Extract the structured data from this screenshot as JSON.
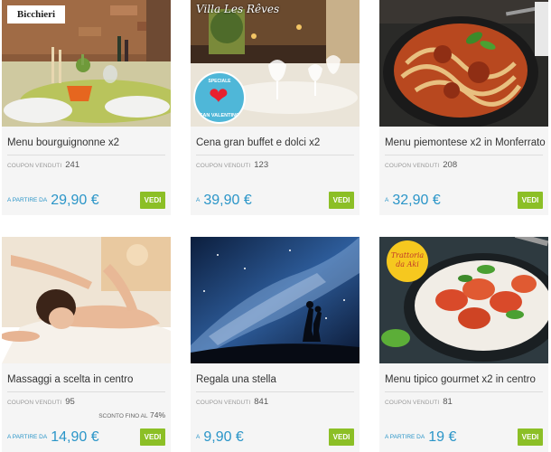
{
  "labels": {
    "sold": "COUPON VENDUTI",
    "from": "A PARTIRE DA",
    "discount": "SCONTO FINO AL",
    "cta": "VEDI"
  },
  "cards": [
    {
      "title": "Menu bourguignonne x2",
      "sold": "241",
      "price": "29,90 €",
      "logo": "Bicchieri"
    },
    {
      "title": "Cena gran buffet e dolci x2",
      "sold": "123",
      "price": "39,90 €",
      "logo": "Villa Les Rêves",
      "badge_top": "SPECIALE",
      "badge_bottom": "SAN VALENTINO"
    },
    {
      "title": "Menu piemontese x2 in Monferrato",
      "sold": "208",
      "price": "32,90 €"
    },
    {
      "title": "Massaggi a scelta in centro",
      "sold": "95",
      "price": "14,90 €",
      "discount": "74%"
    },
    {
      "title": "Regala una stella",
      "sold": "841",
      "price": "9,90 €"
    },
    {
      "title": "Menu tipico gourmet x2 in centro",
      "sold": "81",
      "price": "19 €",
      "logo": "Trattoria da Aki"
    }
  ],
  "colors": {
    "price": "#2a95c8",
    "cta": "#8cbf26"
  }
}
